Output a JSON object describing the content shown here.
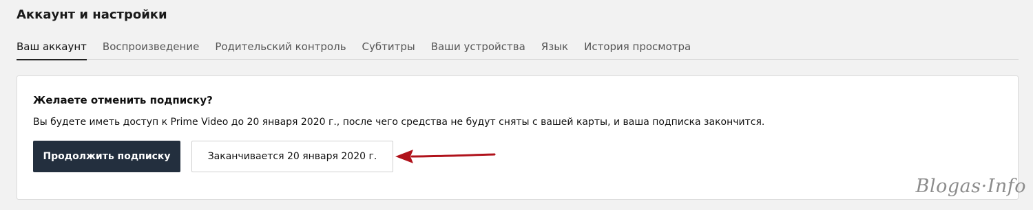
{
  "header": {
    "title": "Аккаунт и настройки"
  },
  "tabs": [
    {
      "label": "Ваш аккаунт",
      "active": true
    },
    {
      "label": "Воспроизведение",
      "active": false
    },
    {
      "label": "Родительский контроль",
      "active": false
    },
    {
      "label": "Субтитры",
      "active": false
    },
    {
      "label": "Ваши устройства",
      "active": false
    },
    {
      "label": "Язык",
      "active": false
    },
    {
      "label": "История просмотра",
      "active": false
    }
  ],
  "cancel_card": {
    "title": "Желаете отменить подписку?",
    "text": "Вы будете иметь доступ к Prime Video до 20 января 2020 г., после чего средства не будут сняты с вашей карты, и ваша подписка закончится.",
    "continue_label": "Продолжить подписку",
    "ends_label": "Заканчивается 20 января 2020 г."
  },
  "annotation": {
    "icon": "arrow-left-icon",
    "color": "#b0121b"
  },
  "watermark": {
    "text": "Blogas·Info"
  },
  "colors": {
    "primary_button": "#232f3e",
    "background": "#f2f2f2"
  }
}
